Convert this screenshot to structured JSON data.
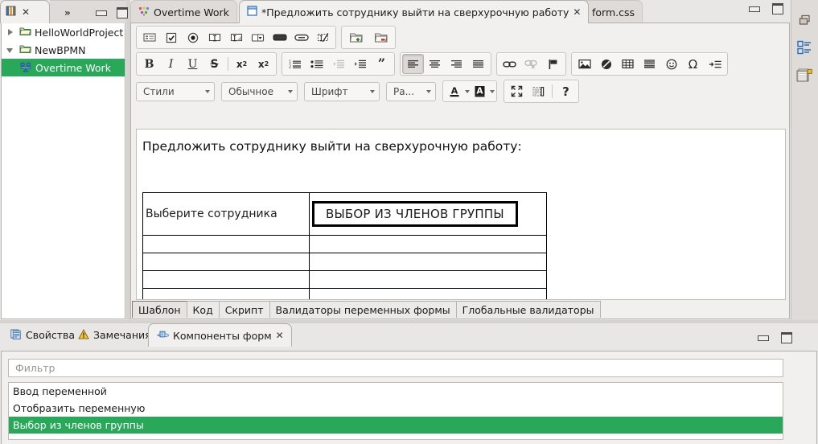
{
  "explorer": {
    "tab": {
      "label": "",
      "icon": "package-explorer-icon",
      "close": "✕"
    },
    "chevrons": "»",
    "tree": [
      {
        "label": "HelloWorldProject",
        "state": "collapsed",
        "icon": "folder-icon",
        "selected": false
      },
      {
        "label": "NewBPMN",
        "state": "expanded",
        "icon": "folder-open-icon",
        "selected": false
      },
      {
        "label": "Overtime Work",
        "state": "leaf",
        "icon": "process-icon",
        "selected": true
      }
    ]
  },
  "editor": {
    "tabs": [
      {
        "label": "Overtime Work",
        "icon": "process-diagram-icon",
        "active": false,
        "closable": false
      },
      {
        "label": "*Предложить сотруднику выйти на сверхурочную работу",
        "icon": "form-icon",
        "active": true,
        "closable": true,
        "close": "✕"
      },
      {
        "label": "form.css",
        "icon": "css-file-icon",
        "active": false,
        "closable": false
      }
    ],
    "window_buttons": [
      {
        "name": "minimize-button",
        "title": "Свернуть"
      },
      {
        "name": "maximize-button",
        "title": "Развернуть"
      }
    ],
    "toolbar_row1": {
      "group1": [
        {
          "name": "input-field-icon",
          "title": "Ввод переменной"
        },
        {
          "name": "checkbox-icon",
          "title": "Флажок"
        },
        {
          "name": "radio-button-icon",
          "title": "Переключатель"
        },
        {
          "name": "text-input-icon",
          "title": "Текстовое поле"
        },
        {
          "name": "textarea-icon",
          "title": "Многострочное поле"
        },
        {
          "name": "dropdown-icon",
          "title": "Выпадающий список"
        },
        {
          "name": "button-icon",
          "title": "Кнопка"
        },
        {
          "name": "pill-button-icon",
          "title": "Ссылка"
        },
        {
          "name": "remove-input-icon",
          "title": "Удалить компонент"
        }
      ],
      "group2": [
        {
          "name": "add-file-icon",
          "title": "Добавить файл"
        },
        {
          "name": "remove-file-icon",
          "title": "Удалить файл"
        }
      ]
    },
    "toolbar_row2": {
      "group_text": [
        {
          "name": "bold-icon",
          "label": "B"
        },
        {
          "name": "italic-icon",
          "label": "I"
        },
        {
          "name": "underline-icon",
          "label": "U"
        },
        {
          "name": "strikethrough-icon",
          "label": "S"
        },
        {
          "name": "subscript-icon",
          "label": "x₂"
        },
        {
          "name": "superscript-icon",
          "label": "x²"
        }
      ],
      "group_list": [
        {
          "name": "numbered-list-icon",
          "enabled": true
        },
        {
          "name": "bulleted-list-icon",
          "enabled": true
        },
        {
          "name": "decrease-indent-icon",
          "enabled": false
        },
        {
          "name": "increase-indent-icon",
          "enabled": true
        },
        {
          "name": "blockquote-icon",
          "enabled": true
        }
      ],
      "group_align": [
        {
          "name": "align-left-icon",
          "pressed": true
        },
        {
          "name": "align-center-icon",
          "pressed": false
        },
        {
          "name": "align-right-icon",
          "pressed": false
        },
        {
          "name": "align-justify-icon",
          "pressed": false
        }
      ],
      "group_link": [
        {
          "name": "insert-link-icon",
          "enabled": true
        },
        {
          "name": "unlink-icon",
          "enabled": false
        },
        {
          "name": "anchor-flag-icon",
          "enabled": true
        }
      ],
      "group_insert": [
        {
          "name": "insert-image-icon"
        },
        {
          "name": "insert-flash-icon"
        },
        {
          "name": "insert-table-icon"
        },
        {
          "name": "horizontal-rule-icon"
        },
        {
          "name": "smiley-icon"
        },
        {
          "name": "special-character-icon"
        },
        {
          "name": "page-break-icon"
        }
      ]
    },
    "toolbar_row3": {
      "styles": "Стили",
      "format": "Обычное",
      "font": "Шрифт",
      "size": "Ра...",
      "text_color": {
        "name": "text-color-icon",
        "label": "A"
      },
      "bg_color": {
        "name": "background-color-icon",
        "label": "A"
      },
      "maximize": {
        "name": "maximize-editor-icon"
      },
      "show_blocks": {
        "name": "show-blocks-icon"
      },
      "help": {
        "name": "help-icon",
        "label": "?"
      }
    },
    "canvas": {
      "title": "Предложить сотруднику выйти на сверхурочную работу:",
      "table": {
        "rows": [
          {
            "tall": true,
            "cells": [
              "Выберите сотрудника",
              "ВЫБОР ИЗ ЧЛЕНОВ ГРУППЫ"
            ],
            "widget_in_cell": 1
          },
          {
            "tall": false,
            "cells": [
              "",
              ""
            ]
          },
          {
            "tall": false,
            "cells": [
              "",
              ""
            ]
          },
          {
            "tall": false,
            "cells": [
              "",
              ""
            ]
          },
          {
            "tall": false,
            "cells": [
              "",
              ""
            ]
          }
        ]
      }
    },
    "bottom_tabs": [
      {
        "label": "Шаблон",
        "active": true
      },
      {
        "label": "Код",
        "active": false
      },
      {
        "label": "Скрипт",
        "active": false
      },
      {
        "label": "Валидаторы переменных формы",
        "active": false
      },
      {
        "label": "Глобальные валидаторы",
        "active": false
      }
    ]
  },
  "rail": [
    {
      "name": "restore-perspective-icon"
    },
    {
      "name": "outline-view-icon"
    },
    {
      "name": "properties-view-icon"
    }
  ],
  "bottom_view": {
    "tabs": [
      {
        "label": "Свойства",
        "icon": "properties-icon",
        "active": false,
        "closable": false
      },
      {
        "label": "Замечания",
        "icon": "warning-icon",
        "active": false,
        "closable": false
      },
      {
        "label": "Компоненты форм",
        "icon": "form-components-icon",
        "active": true,
        "closable": true,
        "close": "✕"
      }
    ],
    "window_buttons": [
      {
        "name": "minimize-button",
        "title": "Свернуть"
      },
      {
        "name": "maximize-button",
        "title": "Развернуть"
      }
    ],
    "filter": {
      "value": "",
      "placeholder": "Фильтр"
    },
    "components": [
      {
        "label": "Ввод переменной",
        "selected": false
      },
      {
        "label": "Отобразить переменную",
        "selected": false
      },
      {
        "label": "Выбор из членов группы",
        "selected": true
      },
      {
        "label": "",
        "selected": false
      }
    ]
  },
  "colors": {
    "selection_green": "#2aa85a",
    "chrome": "#e9e7e5",
    "tab_active": "#f2f0ee"
  }
}
